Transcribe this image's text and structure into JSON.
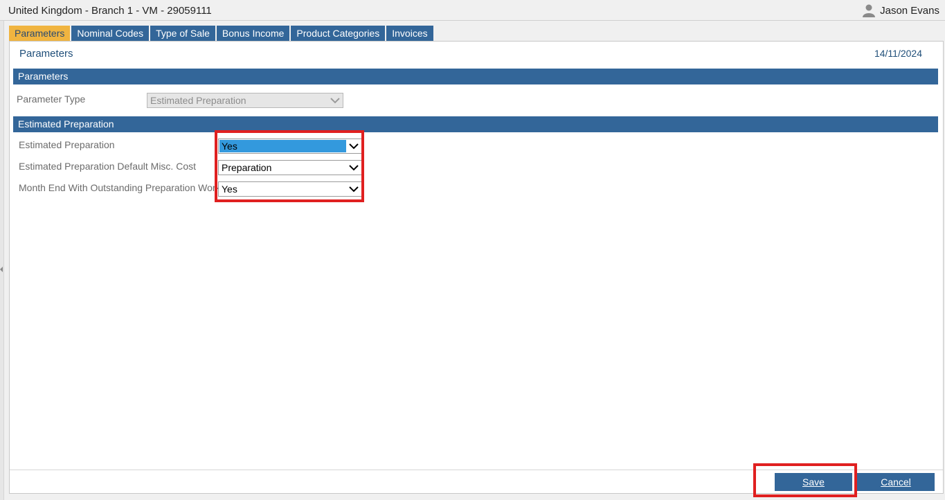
{
  "header": {
    "title": "United Kingdom - Branch 1 - VM - 29059111",
    "user_name": "Jason Evans",
    "user_icon": "user-icon"
  },
  "tabs": [
    {
      "label": "Parameters",
      "active": true
    },
    {
      "label": "Nominal Codes",
      "active": false
    },
    {
      "label": "Type of Sale",
      "active": false
    },
    {
      "label": "Bonus Income",
      "active": false
    },
    {
      "label": "Product Categories",
      "active": false
    },
    {
      "label": "Invoices",
      "active": false
    }
  ],
  "panel": {
    "title": "Parameters",
    "date": "14/11/2024"
  },
  "parameters_section": {
    "title": "Parameters",
    "parameter_type": {
      "label": "Parameter Type",
      "value": "Estimated Preparation",
      "disabled": true
    }
  },
  "estimated_section": {
    "title": "Estimated Preparation",
    "fields": [
      {
        "label": "Estimated Preparation",
        "value": "Yes"
      },
      {
        "label": "Estimated Preparation Default Misc. Cost",
        "value": "Preparation"
      },
      {
        "label": "Month End With Outstanding Preparation Work",
        "value": "Yes"
      }
    ]
  },
  "buttons": {
    "save": "Save",
    "cancel": "Cancel"
  },
  "colors": {
    "accent": "#336699",
    "active_tab": "#f0b440",
    "highlight": "#e02020",
    "selection": "#3399dd"
  }
}
